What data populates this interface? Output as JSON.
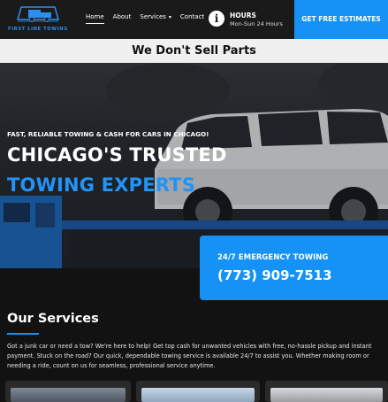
{
  "header": {
    "logo_text": "FIRST LINE TOWING",
    "nav": [
      {
        "label": "Home"
      },
      {
        "label": "About"
      },
      {
        "label": "Services"
      },
      {
        "label": "Contact"
      }
    ],
    "hours_title": "HOURS",
    "hours_value": "Mon-Sun 24 Hours",
    "cta_label": "GET FREE ESTIMATES"
  },
  "banner": {
    "text": "We Don't Sell Parts"
  },
  "hero": {
    "kicker": "FAST, RELIABLE TOWING & CASH FOR CARS IN CHICAGO!",
    "heading_line1": "CHICAGO'S TRUSTED",
    "heading_line2": "TOWING EXPERTS"
  },
  "emergency": {
    "title": "24/7 EMERGENCY TOWING",
    "phone": "(773) 909-7513"
  },
  "services": {
    "title": "Our Services",
    "description": "Got a junk car or need a tow? We're here to help! Get top cash for unwanted vehicles with free, no-hassle pickup and instant payment. Stuck on the road? Our quick, dependable towing service is available 24/7 to assist you. Whether making room or needing a ride, count on us for seamless, professional service anytime."
  },
  "colors": {
    "accent": "#1691f5",
    "header_bg": "#1a1a1a",
    "page_bg": "#121212"
  }
}
